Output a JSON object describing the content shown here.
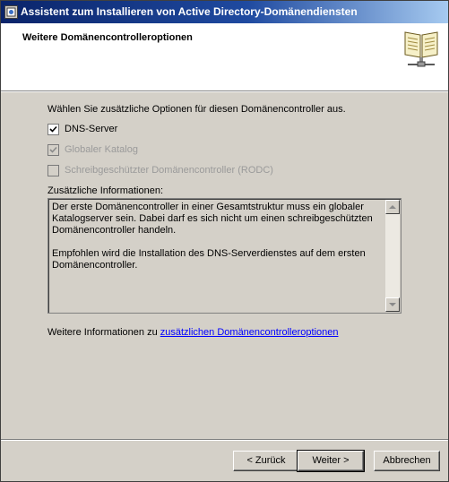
{
  "window": {
    "title": "Assistent zum Installieren von Active Directory-Domänendiensten"
  },
  "header": {
    "title": "Weitere Domänencontrolleroptionen"
  },
  "main": {
    "intro": "Wählen Sie zusätzliche Optionen für diesen Domänencontroller aus.",
    "options": [
      {
        "label": "DNS-Server",
        "checked": true,
        "enabled": true
      },
      {
        "label": "Globaler Katalog",
        "checked": true,
        "enabled": false
      },
      {
        "label": "Schreibgeschützter Domänencontroller (RODC)",
        "checked": false,
        "enabled": false
      }
    ],
    "info_label": "Zusätzliche Informationen:",
    "info_paragraphs": [
      "Der erste Domänencontroller in einer Gesamtstruktur muss ein globaler Katalogserver sein. Dabei darf es sich nicht um einen schreibgeschützten Domänencontroller handeln.",
      "Empfohlen wird die Installation des DNS-Serverdienstes auf dem ersten Domänencontroller."
    ],
    "more_info_prefix": "Weitere Informationen zu ",
    "more_info_link": "zusätzlichen Domänencontrolleroptionen"
  },
  "buttons": {
    "back": "< Zurück",
    "next": "Weiter >",
    "cancel": "Abbrechen"
  },
  "icons": {
    "app": "wizard-app-icon",
    "header": "book-network-icon"
  }
}
